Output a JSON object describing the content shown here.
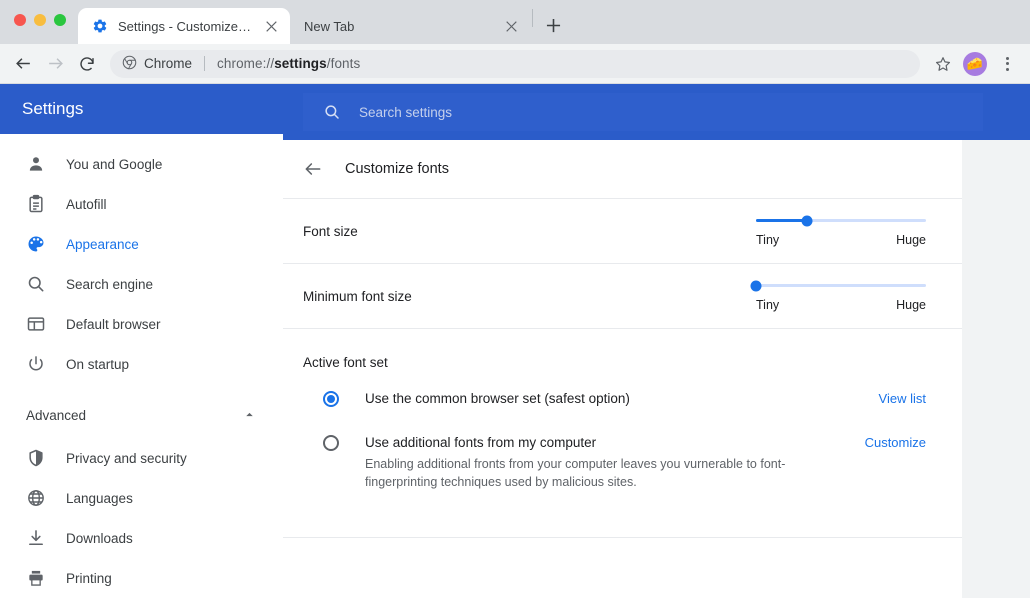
{
  "window": {
    "traffic_lights": [
      "close",
      "minimize",
      "maximize"
    ],
    "tabs": [
      {
        "title": "Settings - Customize fonts",
        "favicon": "gear-icon",
        "active": true,
        "close": "×"
      },
      {
        "title": "New Tab",
        "favicon": "none",
        "active": false,
        "close": "×"
      }
    ],
    "new_tab_label": "+"
  },
  "toolbar": {
    "back": "back-arrow-icon",
    "forward": "forward-arrow-icon",
    "reload": "reload-icon",
    "omnibox": {
      "chip_label": "Chrome",
      "chip_icon": "chrome-logo-icon",
      "url_prefix": "chrome://",
      "url_bold": "settings",
      "url_suffix": "/fonts"
    },
    "bookmark": "star-icon",
    "avatar_glyph": "🧀",
    "avatar_color": "#a77be0",
    "menu": "three-dot-menu-icon"
  },
  "sidebar": {
    "title": "Settings",
    "header_color": "#2b5cc9",
    "items": [
      {
        "label": "You and Google",
        "icon": "person-icon",
        "selected": false
      },
      {
        "label": "Autofill",
        "icon": "clipboard-icon",
        "selected": false
      },
      {
        "label": "Appearance",
        "icon": "palette-icon",
        "selected": true
      },
      {
        "label": "Search engine",
        "icon": "search-icon",
        "selected": false
      },
      {
        "label": "Default browser",
        "icon": "browser-window-icon",
        "selected": false
      },
      {
        "label": "On startup",
        "icon": "power-icon",
        "selected": false
      }
    ],
    "advanced": {
      "label": "Advanced",
      "expanded": true,
      "chevron": "chevron-up-icon"
    },
    "advanced_items": [
      {
        "label": "Privacy and security",
        "icon": "shield-icon",
        "selected": false
      },
      {
        "label": "Languages",
        "icon": "globe-icon",
        "selected": false
      },
      {
        "label": "Downloads",
        "icon": "download-icon",
        "selected": false
      },
      {
        "label": "Printing",
        "icon": "printer-icon",
        "selected": false
      }
    ]
  },
  "search": {
    "placeholder": "Search settings",
    "value": "",
    "icon": "search-icon"
  },
  "main": {
    "back_icon": "back-arrow-icon",
    "page_title": "Customize fonts",
    "sliders": [
      {
        "label": "Font size",
        "min_label": "Tiny",
        "max_label": "Huge",
        "percent": 30
      },
      {
        "label": "Minimum font size",
        "min_label": "Tiny",
        "max_label": "Huge",
        "percent": 0
      }
    ],
    "font_set": {
      "title": "Active font set",
      "options": [
        {
          "label": "Use the common browser set (safest option)",
          "description": "",
          "selected": true,
          "action_label": "View list"
        },
        {
          "label": "Use additional fonts from my computer",
          "description": "Enabling additional fronts from your computer leaves you vurnerable to font-fingerprinting techniques used by malicious sites.",
          "selected": false,
          "action_label": "Customize"
        }
      ]
    }
  },
  "colors": {
    "accent": "#1a73e8",
    "header_blue": "#2b5cc9",
    "page_bg": "#f1f3f4",
    "card_bg": "#ffffff",
    "text_primary": "#202124",
    "text_secondary": "#5f6368"
  }
}
